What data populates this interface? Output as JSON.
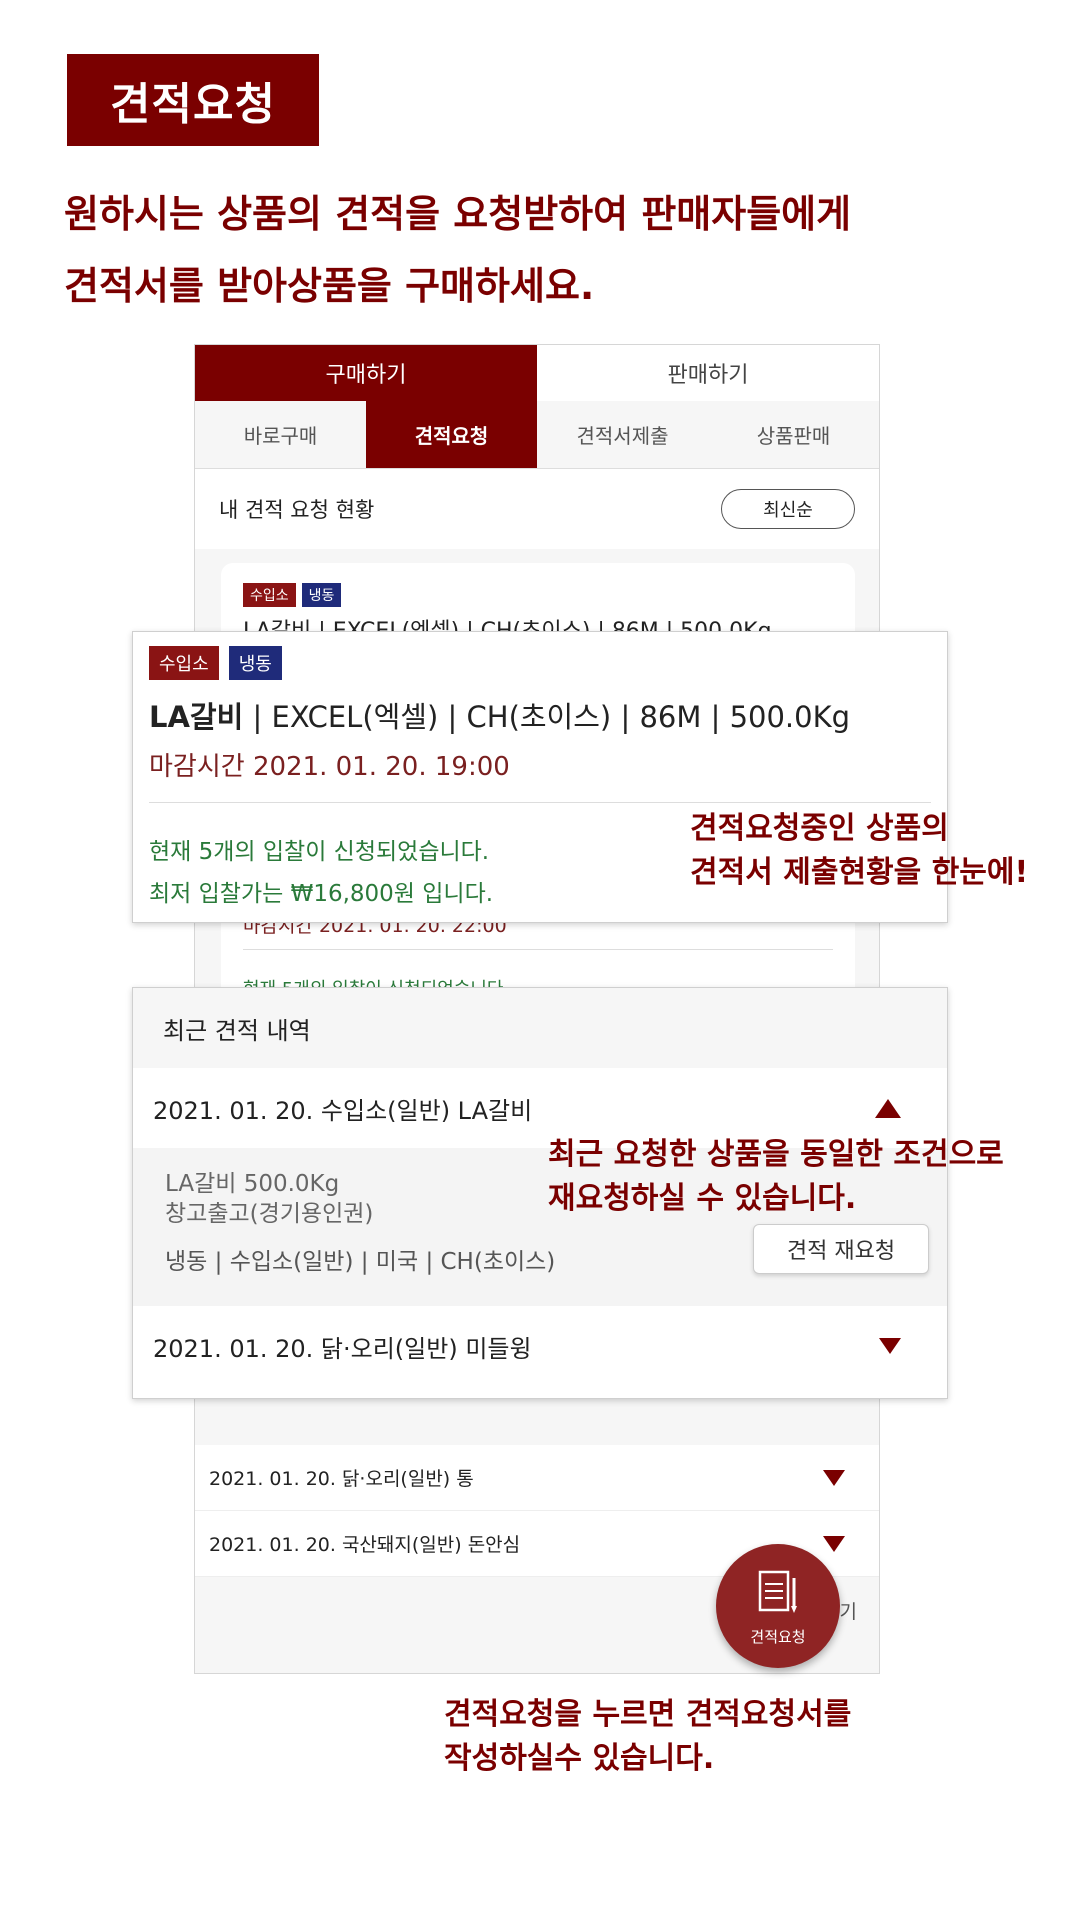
{
  "header": {
    "badge": "견적요청",
    "intro_line1": "원하시는 상품의 견적을 요청받하여 판매자들에게",
    "intro_line2": "견적서를 받아상품을 구매하세요."
  },
  "phone": {
    "main_tabs": [
      "구매하기",
      "판매하기"
    ],
    "sub_tabs": [
      "바로구매",
      "견적요청",
      "견적서제출",
      "상품판매"
    ],
    "status_title": "내 견적 요청 현황",
    "sort_label": "최신순",
    "bg_card": {
      "tags": [
        "수입소",
        "냉동"
      ],
      "name": "LA갈비 | EXCEL(엑셀) | CH(초이스) | 86M | 500.0Kg",
      "deadline": "마감시간 2021. 01. 20. 22:00",
      "bid": "현재 5개의 입찰이 신청되었습니다."
    },
    "list_items": [
      "2021. 01. 20. 닭·오리(일반) 통",
      "2021. 01. 20. 국산돼지(일반) 돈안심"
    ],
    "more": "더보기",
    "fab_label": "견적요청"
  },
  "popup_request": {
    "tags": [
      "수입소",
      "냉동"
    ],
    "name_bold": "LA갈비",
    "name_rest": " | EXCEL(엑셀) | CH(초이스) | 86M | 500.0Kg",
    "deadline": "마감시간 2021. 01. 20. 19:00",
    "bid_count": "현재 5개의 입찰이 신청되었습니다.",
    "lowest_bid": "최저 입찰가는 ₩16,800원 입니다."
  },
  "popup_recent": {
    "title": "최근 견적 내역",
    "item1": "2021. 01. 20. 수입소(일반) LA갈비",
    "detail_line1": "LA갈비 500.0Kg",
    "detail_line2": "창고출고(경기용인권)",
    "detail_line3": "냉동 | 수입소(일반) | 미국 | CH(초이스)",
    "rerequest": "견적 재요청",
    "item2": "2021. 01. 20. 닭·오리(일반) 미들윙"
  },
  "callouts": {
    "c1_line1": "견적요청중인 상품의",
    "c1_line2": "견적서 제출현황을 한눈에!",
    "c2_line1": "최근 요청한 상품을 동일한 조건으로",
    "c2_line2": "재요청하실 수  있습니다.",
    "c3_line1": "견적요청을 누르면 견적요청서를",
    "c3_line2": "작성하실수  있습니다."
  },
  "colors": {
    "brand": "#7a0000",
    "tag_red": "#8a1414",
    "tag_navy": "#1f2b7a",
    "bid_green": "#2a7a3a"
  },
  "icons": [
    "pencil-document-icon",
    "triangle-up-icon",
    "triangle-down-icon"
  ]
}
